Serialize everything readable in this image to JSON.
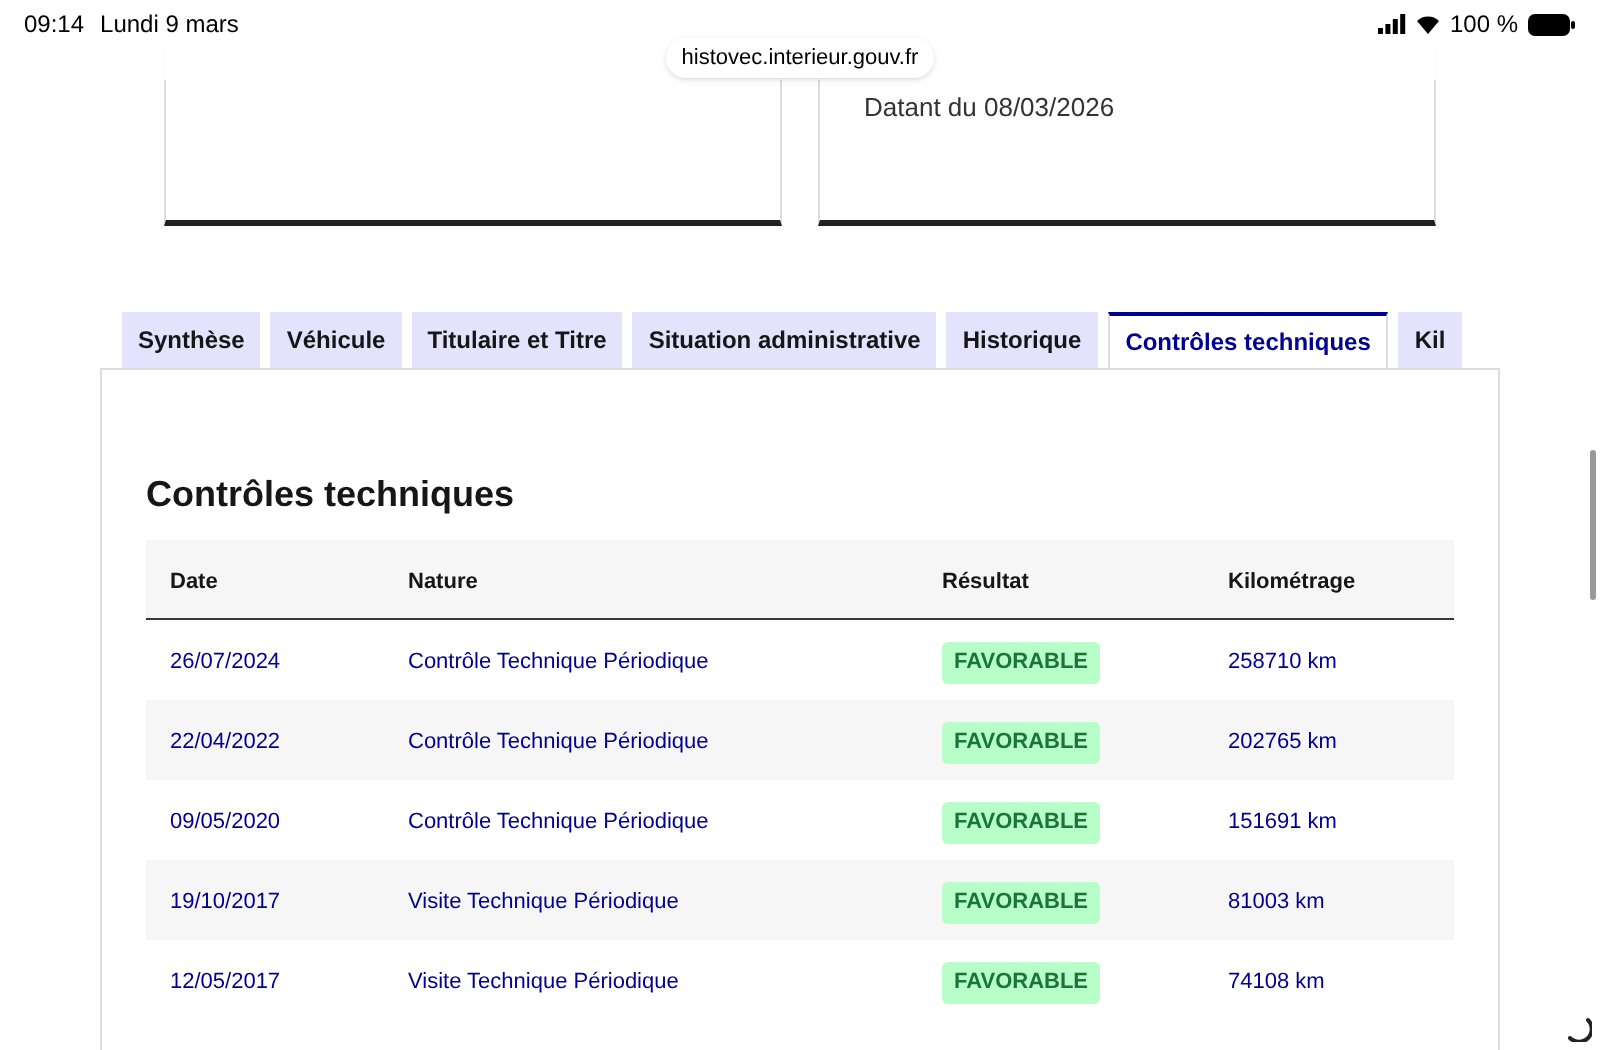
{
  "status_bar": {
    "time": "09:14",
    "date": "Lundi 9 mars",
    "url": "histovec.interieur.gouv.fr",
    "battery": "100 %"
  },
  "cards": [
    {
      "text": "Datant du 08/03/2026"
    }
  ],
  "tabs": [
    {
      "label": "Synthèse",
      "selected": false
    },
    {
      "label": "Véhicule",
      "selected": false
    },
    {
      "label": "Titulaire et Titre",
      "selected": false
    },
    {
      "label": "Situation administrative",
      "selected": false
    },
    {
      "label": "Historique",
      "selected": false
    },
    {
      "label": "Contrôles techniques",
      "selected": true
    },
    {
      "label": "Kil",
      "selected": false
    }
  ],
  "section": {
    "title": "Contrôles techniques",
    "columns": [
      "Date",
      "Nature",
      "Résultat",
      "Kilométrage"
    ],
    "rows": [
      {
        "date": "26/07/2024",
        "nature": "Contrôle Technique Périodique",
        "result": "FAVORABLE",
        "mileage": "258710 km"
      },
      {
        "date": "22/04/2022",
        "nature": "Contrôle Technique Périodique",
        "result": "FAVORABLE",
        "mileage": "202765 km"
      },
      {
        "date": "09/05/2020",
        "nature": "Contrôle Technique Périodique",
        "result": "FAVORABLE",
        "mileage": "151691 km"
      },
      {
        "date": "19/10/2017",
        "nature": "Visite Technique Périodique",
        "result": "FAVORABLE",
        "mileage": "81003 km"
      },
      {
        "date": "12/05/2017",
        "nature": "Visite Technique Périodique",
        "result": "FAVORABLE",
        "mileage": "74108 km"
      }
    ]
  }
}
